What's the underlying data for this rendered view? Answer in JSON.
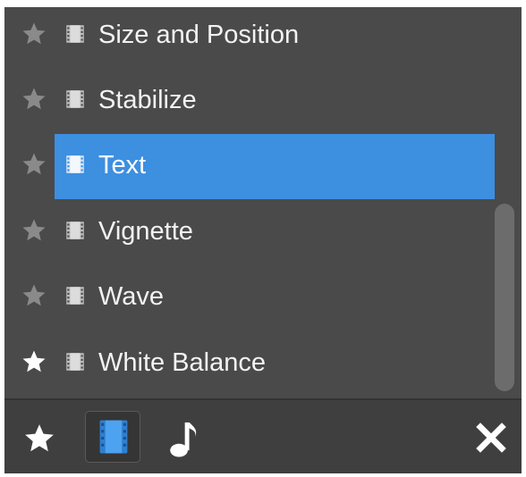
{
  "effects_list": {
    "items": [
      {
        "label": "Size and Position",
        "favorite": false,
        "selected": false
      },
      {
        "label": "Stabilize",
        "favorite": false,
        "selected": false
      },
      {
        "label": "Text",
        "favorite": false,
        "selected": true
      },
      {
        "label": "Vignette",
        "favorite": false,
        "selected": false
      },
      {
        "label": "Wave",
        "favorite": false,
        "selected": false
      },
      {
        "label": "White Balance",
        "favorite": true,
        "selected": false
      }
    ]
  },
  "toolbar": {
    "favorites_icon": "star-icon",
    "video_icon": "film-strip-icon",
    "audio_icon": "music-note-icon",
    "close_icon": "close-icon"
  },
  "colors": {
    "panel_bg": "#4a4a4a",
    "selection": "#3d8fe0",
    "text": "#f2f2f2",
    "star_inactive": "#8a8a8a",
    "star_active": "#ffffff"
  }
}
